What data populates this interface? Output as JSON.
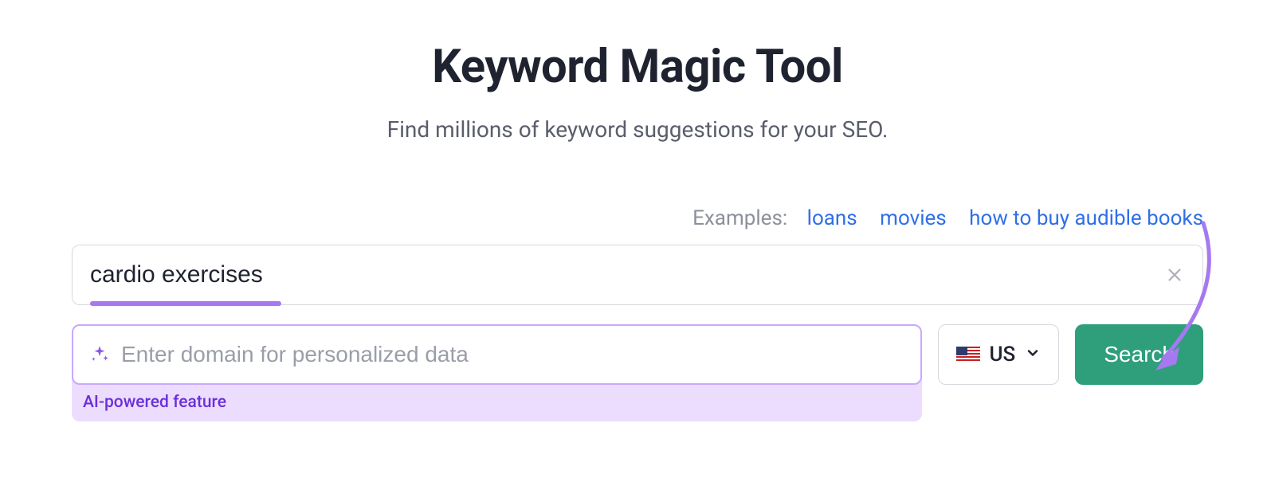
{
  "header": {
    "title": "Keyword Magic Tool",
    "subtitle": "Find millions of keyword suggestions for your SEO."
  },
  "examples": {
    "label": "Examples:",
    "items": [
      "loans",
      "movies",
      "how to buy audible books"
    ]
  },
  "keyword": {
    "value": "cardio exercises",
    "clear_icon": "close"
  },
  "domain": {
    "placeholder": "Enter domain for personalized data",
    "ai_label": "AI-powered feature",
    "sparkle_icon": "sparkle"
  },
  "country": {
    "flag": "us-flag",
    "label": "US",
    "chevron_icon": "chevron-down"
  },
  "search_button": {
    "label": "Search"
  }
}
